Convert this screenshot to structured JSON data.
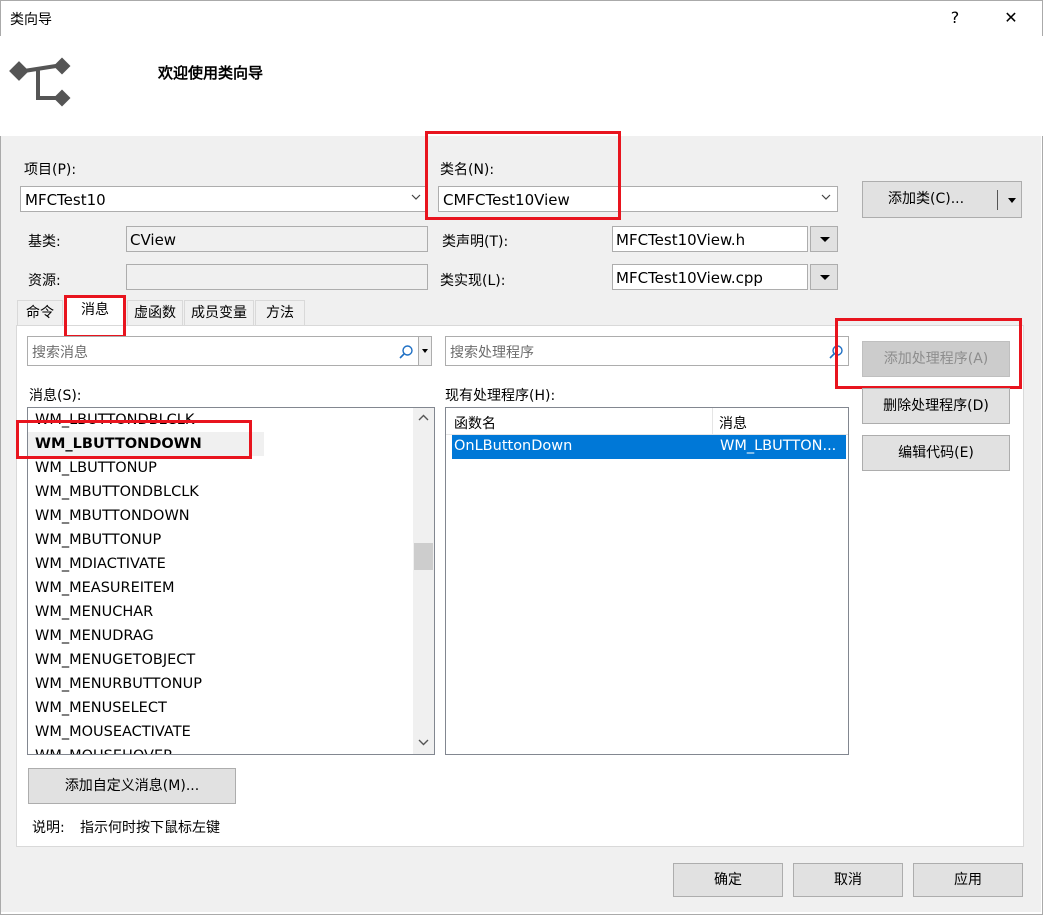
{
  "window": {
    "title": "类向导",
    "help": "?",
    "close": "✕"
  },
  "header": {
    "welcome": "欢迎使用类向导"
  },
  "project": {
    "label": "项目(P):",
    "value": "MFCTest10"
  },
  "classname": {
    "label": "类名(N):",
    "value": "CMFCTest10View"
  },
  "add_class_button": "添加类(C)...",
  "base": {
    "label": "基类:",
    "value": "CView"
  },
  "resource": {
    "label": "资源:",
    "value": ""
  },
  "class_decl": {
    "label": "类声明(T):",
    "value": "MFCTest10View.h"
  },
  "class_impl": {
    "label": "类实现(L):",
    "value": "MFCTest10View.cpp"
  },
  "tabs": [
    "命令",
    "消息",
    "虚函数",
    "成员变量",
    "方法"
  ],
  "search_messages": {
    "placeholder": "搜索消息"
  },
  "search_handlers": {
    "placeholder": "搜索处理程序"
  },
  "messages": {
    "label": "消息(S):",
    "items": [
      "WM_LBUTTONDBLCLK",
      "WM_LBUTTONDOWN",
      "WM_LBUTTONUP",
      "WM_MBUTTONDBLCLK",
      "WM_MBUTTONDOWN",
      "WM_MBUTTONUP",
      "WM_MDIACTIVATE",
      "WM_MEASUREITEM",
      "WM_MENUCHAR",
      "WM_MENUDRAG",
      "WM_MENUGETOBJECT",
      "WM_MENURBUTTONUP",
      "WM_MENUSELECT",
      "WM_MOUSEACTIVATE",
      "WM_MOUSEHOVER"
    ],
    "selected_index": 1
  },
  "handlers": {
    "label": "现有处理程序(H):",
    "col_func": "函数名",
    "col_msg": "消息",
    "rows": [
      {
        "func": "OnLButtonDown",
        "msg": "WM_LBUTTON..."
      }
    ]
  },
  "buttons": {
    "add_handler": "添加处理程序(A)",
    "delete_handler": "删除处理程序(D)",
    "edit_code": "编辑代码(E)",
    "add_custom_msg": "添加自定义消息(M)...",
    "ok": "确定",
    "cancel": "取消",
    "apply": "应用"
  },
  "description": {
    "label": "说明:",
    "text": "指示何时按下鼠标左键"
  },
  "colors": {
    "selection": "#0078d7",
    "highlight": "#e8141e"
  },
  "icons": [
    "class-wizard-icon",
    "search-icon",
    "chevron-down-icon",
    "scroll-up-icon",
    "scroll-down-icon"
  ]
}
